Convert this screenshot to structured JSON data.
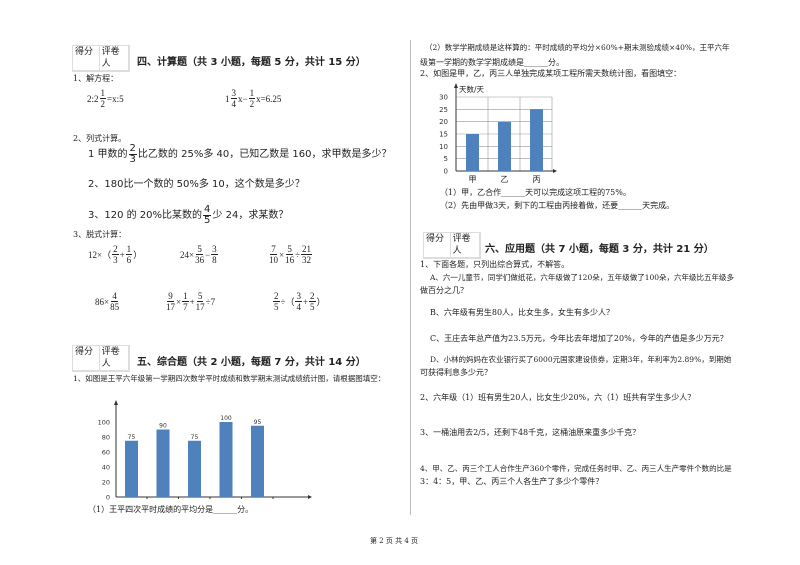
{
  "score_box": {
    "score": "得分",
    "reviewer": "评卷人"
  },
  "section4": {
    "title": "四、计算题（共 3 小题，每题 5 分，共计 15 分）",
    "q1_label": "1、解方程：",
    "q1_eq": [
      [
        {
          "t": "2:2"
        },
        {
          "n": "1",
          "d": "2"
        },
        {
          "t": "=x:5"
        }
      ],
      [
        {
          "t": "1"
        },
        {
          "n": "3",
          "d": "4"
        },
        {
          "t": "x−"
        },
        {
          "n": "1",
          "d": "2"
        },
        {
          "t": "x=6.25"
        }
      ]
    ],
    "q2_label": "2、列式计算。",
    "q2_items": [
      [
        {
          "t": "1 甲数的"
        },
        {
          "n": "2",
          "d": "3"
        },
        {
          "t": "比乙数的 25%多 40，已知乙数是 160，求甲数是多少？"
        }
      ],
      [
        {
          "t": "2、180比一个数的 50%多 10，这个数是多少？"
        }
      ],
      [
        {
          "t": "3、120 的 20%比某数的"
        },
        {
          "n": "4",
          "d": "5"
        },
        {
          "t": "少 24，求某数？"
        }
      ]
    ],
    "q3_label": "3、脱式计算：",
    "q3_items": [
      [
        {
          "t": "12×（"
        },
        {
          "n": "2",
          "d": "3"
        },
        {
          "t": "+"
        },
        {
          "n": "1",
          "d": "6"
        },
        {
          "t": "）"
        }
      ],
      [
        {
          "t": "24×"
        },
        {
          "n": "5",
          "d": "36"
        },
        {
          "t": "−"
        },
        {
          "n": "3",
          "d": "8"
        }
      ],
      [
        {
          "n": "7",
          "d": "10"
        },
        {
          "t": "×"
        },
        {
          "n": "5",
          "d": "16"
        },
        {
          "t": "÷"
        },
        {
          "n": "21",
          "d": "32"
        }
      ],
      [
        {
          "t": "86×"
        },
        {
          "n": "4",
          "d": "85"
        }
      ],
      [
        {
          "n": "9",
          "d": "17"
        },
        {
          "t": "×"
        },
        {
          "n": "1",
          "d": "7"
        },
        {
          "t": "+"
        },
        {
          "n": "5",
          "d": "17"
        },
        {
          "t": "÷7"
        }
      ],
      [
        {
          "n": "2",
          "d": "5"
        },
        {
          "t": "÷（"
        },
        {
          "n": "3",
          "d": "4"
        },
        {
          "t": "+"
        },
        {
          "n": "2",
          "d": "5"
        },
        {
          "t": "）"
        }
      ]
    ]
  },
  "section5": {
    "title": "五、综合题（共 2 小题，每题 7 分，共计 14 分）",
    "q1_text": "1、如图是王平六年级第一学期四次数学平时成绩和数学期末测试成绩统计图，请根据图填空：",
    "q1_sub1": "（1）王平四次平时成绩的平均分是______分。",
    "q1_sub2": "（2）数学学期成绩是这样算的：平时成绩的平均分×60%+期末测验成绩×40%，王平六年",
    "q1_sub2b": "级第一学期的数学学期成绩是______分。",
    "q2_text": "2、如图是甲，乙，丙三人单独完成某项工程所需天数统计图，看图填空：",
    "q2_sub1": "（1）甲，乙合作______天可以完成这项工程的75%。",
    "q2_sub2": "（2）先由甲做3天，剩下的工程由丙接着做，还要______天完成。"
  },
  "chart_data": [
    {
      "type": "bar",
      "values": [
        75,
        90,
        75,
        100,
        95
      ],
      "data_labels": [
        "75",
        "90",
        "75",
        "100",
        "95"
      ],
      "yticks": [
        "0",
        "20",
        "40",
        "60",
        "80",
        "100"
      ],
      "ylim": [
        0,
        100
      ],
      "grid": false,
      "bar_color": "#4f81bd"
    },
    {
      "type": "bar",
      "categories": [
        "甲",
        "乙",
        "丙"
      ],
      "values": [
        15,
        20,
        25
      ],
      "ylabel": "天数/天",
      "yticks": [
        "0",
        "5",
        "10",
        "15",
        "20",
        "25",
        "30"
      ],
      "ylim": [
        0,
        30
      ],
      "grid": true,
      "bar_color": "#4f81bd"
    }
  ],
  "section6": {
    "title": "六、应用题（共 7 小题，每题 3 分，共计 21 分）",
    "q1": "1、下面各题，只列出综合算式，不解答。",
    "q1a": "A、六一儿童节，同学们做纸花，六年级做了120朵，五年级做了100朵，六年级比五年级多",
    "q1a2": "做百分之几？",
    "q1b": "B、六年级有男生80人，比女生多，女生有多少人？",
    "q1c": "C、王庄去年总产值为23.5万元，今年比去年增加了20%，今年的产值是多少万元？",
    "q1d": "D、小林的妈妈在农业银行买了6000元国家建设债券，定期3年，年利率为2.89%，到期她",
    "q1d2": "可获得利息多少元？",
    "q2": "2、六年级（1）班有男生20人，比女生少20%，六（1）班共有学生多少人？",
    "q3": "3、一桶油用去2/5，还剩下48千克，这桶油原来重多少千克？",
    "q4": "4、甲、乙、丙三个工人合作生产360个零件，完成任务时甲、乙、丙三人生产零件个数的比是",
    "q4b": "3：4：5，甲、乙、丙三个人各生产了多少个零件？"
  },
  "footer": "第 2 页 共 4 页"
}
